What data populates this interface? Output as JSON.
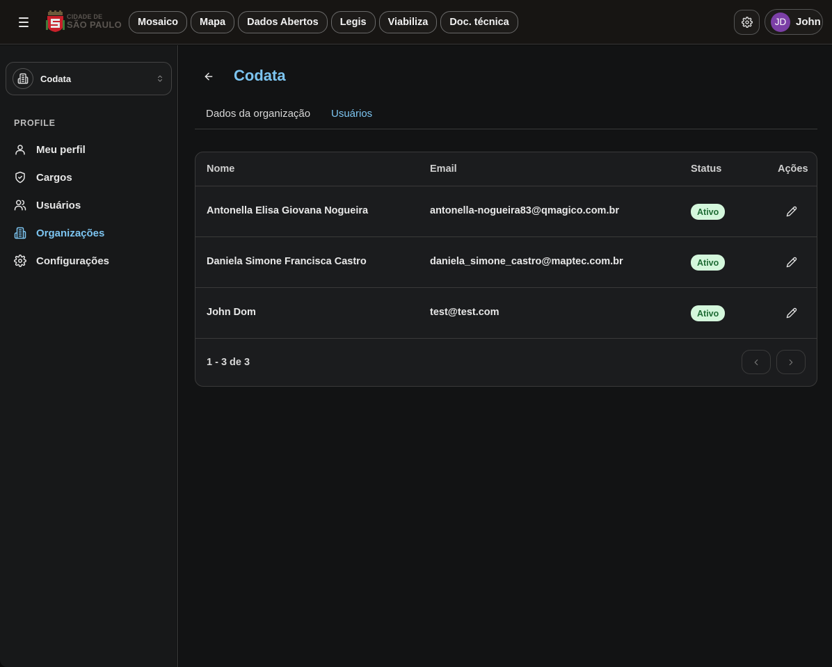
{
  "header": {
    "logo": {
      "line1": "CIDADE DE",
      "line2": "SÃO PAULO"
    },
    "nav": [
      "Mosaico",
      "Mapa",
      "Dados Abertos",
      "Legis",
      "Viabiliza",
      "Doc. técnica"
    ],
    "user": {
      "initials": "JD",
      "name": "John",
      "avatar_color": "#7b3fa6"
    }
  },
  "sidebar": {
    "org_selector": {
      "value": "Codata"
    },
    "section_label": "PROFILE",
    "items": [
      {
        "label": "Meu perfil",
        "icon": "user-icon",
        "active": false
      },
      {
        "label": "Cargos",
        "icon": "shield-check-icon",
        "active": false
      },
      {
        "label": "Usuários",
        "icon": "users-icon",
        "active": false
      },
      {
        "label": "Organizações",
        "icon": "building-icon",
        "active": true
      },
      {
        "label": "Configurações",
        "icon": "gear-icon",
        "active": false
      }
    ]
  },
  "main": {
    "title": "Codata",
    "tabs": [
      {
        "label": "Dados da organização",
        "active": false
      },
      {
        "label": "Usuários",
        "active": true
      }
    ],
    "table": {
      "columns": [
        "Nome",
        "Email",
        "Status",
        "Ações"
      ],
      "rows": [
        {
          "name": "Antonella Elisa Giovana Nogueira",
          "email": "antonella-nogueira83@qmagico.com.br",
          "status": "Ativo"
        },
        {
          "name": "Daniela Simone Francisca Castro",
          "email": "daniela_simone_castro@maptec.com.br",
          "status": "Ativo"
        },
        {
          "name": "John Dom",
          "email": "test@test.com",
          "status": "Ativo"
        }
      ],
      "pagination": "1 - 3 de 3"
    }
  },
  "colors": {
    "accent": "#7cc4f0",
    "badge_bg": "#d4f7dc",
    "badge_text": "#1e6b34"
  }
}
